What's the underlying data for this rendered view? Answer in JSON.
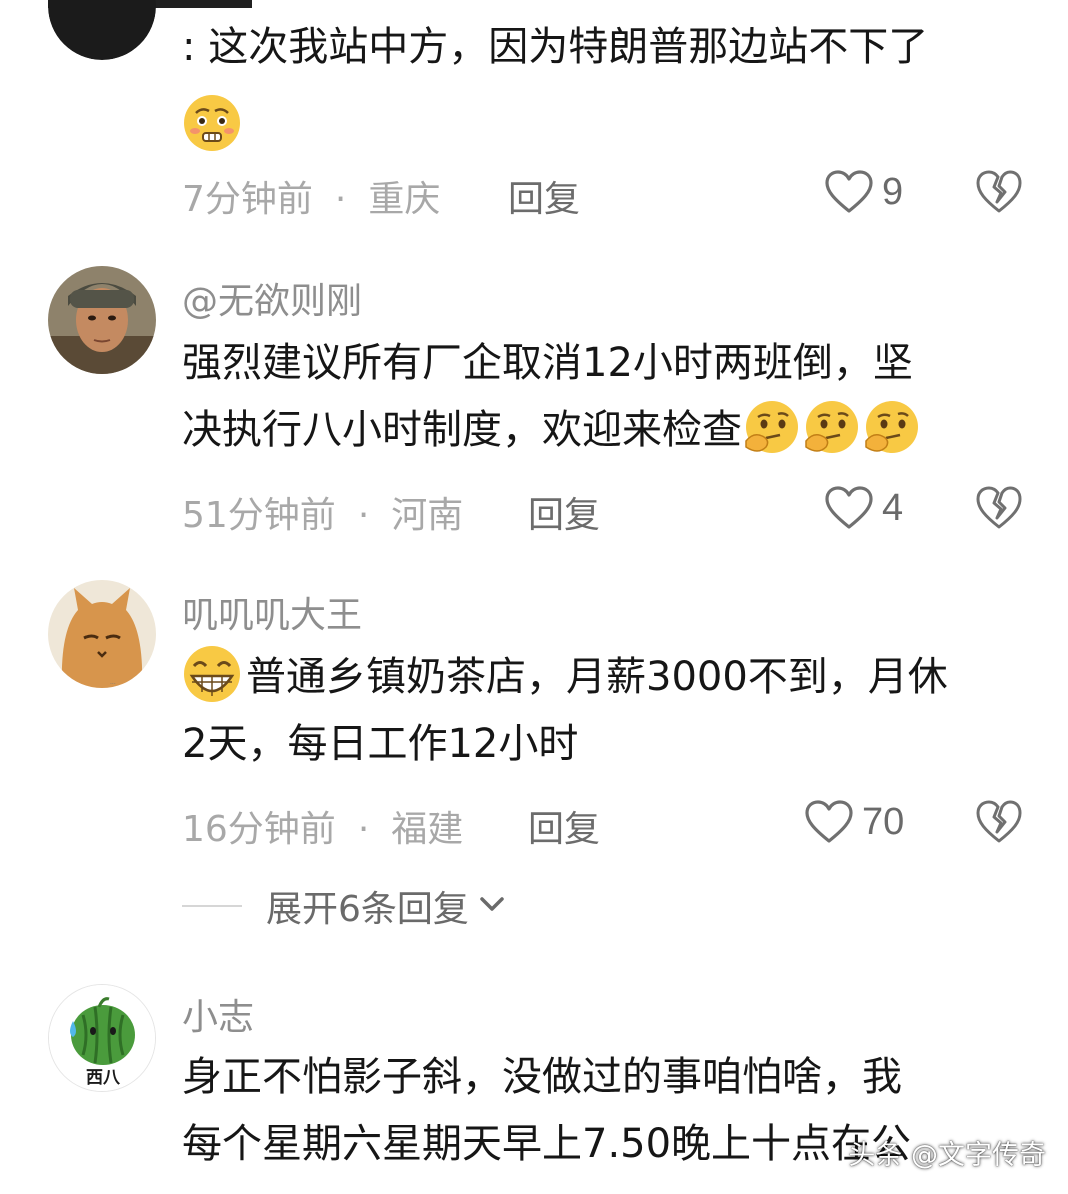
{
  "comments": [
    {
      "username": "",
      "lines": [
        ": 这次我站中方，因为特朗普那边站不下了",
        ""
      ],
      "time": "7分钟前",
      "location": "重庆",
      "reply_label": "回复",
      "likes": "9"
    },
    {
      "username": "@无欲则刚",
      "lines": [
        "强烈建议所有厂企取消12小时两班倒，坚",
        "决执行八小时制度，欢迎来检查"
      ],
      "time": "51分钟前",
      "location": "河南",
      "reply_label": "回复",
      "likes": "4"
    },
    {
      "username": "叽叽叽大王",
      "lines": [
        "普通乡镇奶茶店，月薪3000不到，月休",
        "2天，每日工作12小时"
      ],
      "time": "16分钟前",
      "location": "福建",
      "reply_label": "回复",
      "likes": "70"
    },
    {
      "username": "小志",
      "avatar_text": "西八",
      "lines": [
        "身正不怕影子斜，没做过的事咱怕啥，我",
        "每个星期六星期天早上7.50晚上十点在公"
      ]
    }
  ],
  "expand_replies": "展开6条回复",
  "watermark": "头条 @文字传奇",
  "icons": {
    "like": "heart-outline-icon",
    "dislike": "broken-heart-icon",
    "expand": "chevron-down-icon",
    "emoji_pleading": "pleading-face-emoji",
    "emoji_thinking": "thinking-face-emoji",
    "emoji_grin": "grinning-face-emoji"
  },
  "colors": {
    "primary_text": "#161616",
    "meta_text": "#a8a8a8",
    "username_text": "#8e8e8e",
    "action_text": "#6c6c6c",
    "icon_stroke": "#707070",
    "emoji_yellow": "#f7c948"
  }
}
